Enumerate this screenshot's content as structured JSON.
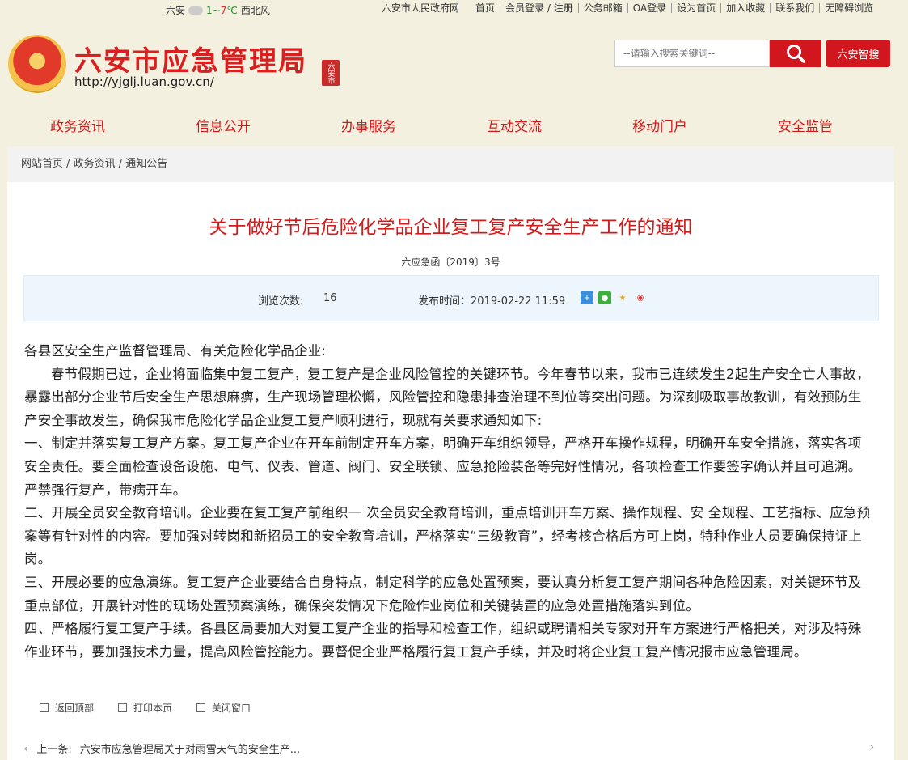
{
  "topbar": {
    "city": "六安",
    "temp_low": "1",
    "temp_sep": "~",
    "temp_high": "7",
    "temp_unit": "℃",
    "wind": "西北风",
    "links": [
      "六安市人民政府网",
      "首页",
      "会员登录 / 注册",
      "公务邮箱",
      "OA登录",
      "设为首页",
      "加入收藏",
      "联系我们",
      "无障碍浏览"
    ]
  },
  "header": {
    "title": "六安市应急管理局",
    "url": "http://yjglj.luan.gov.cn/",
    "seal_text": "六安市",
    "search_placeholder": "--请输入搜索关键词--",
    "smart_search": "六安智搜"
  },
  "nav": [
    "政务资讯",
    "信息公开",
    "办事服务",
    "互动交流",
    "移动门户",
    "安全监管"
  ],
  "breadcrumb": "网站首页 / 政务资讯 / 通知公告",
  "article": {
    "title": "关于做好节后危险化学品企业复工复产安全生产工作的通知",
    "doc_number": "六应急函〔2019〕3号",
    "views_label": "浏览次数:",
    "views": "16",
    "published_label": "发布时间：2019-02-22 11:59",
    "paragraphs": [
      "各县区安全生产监督管理局、有关危险化学品企业:",
      "春节假期已过，企业将面临集中复工复产，复工复产是企业风险管控的关键环节。今年春节以来，我市已连续发生2起生产安全亡人事故，暴露出部分企业节后安全生产思想麻痹，生产现场管理松懈，风险管控和隐患排查治理不到位等突出问题。为深刻吸取事故教训，有效预防生产安全事故发生，确保我市危险化学品企业复工复产顺利进行，现就有关要求通知如下:",
      "一、制定并落实复工复产方案。复工复产企业在开车前制定开车方案，明确开车组织领导，严格开车操作规程，明确开车安全措施，落实各项安全责任。要全面检查设备设施、电气、仪表、管道、阀门、安全联锁、应急抢险装备等完好性情况，各项检查工作要签字确认并且可追溯。严禁强行复产，带病开车。",
      "二、开展全员安全教育培训。企业要在复工复产前组织一 次全员安全教育培训，重点培训开车方案、操作规程、安 全规程、工艺指标、应急预案等有针对性的内容。要加强对转岗和新招员工的安全教育培训，严格落实“三级教育”，经考核合格后方可上岗，特种作业人员要确保持证上岗。",
      "三、开展必要的应急演练。复工复产企业要结合自身特点，制定科学的应急处置预案，要认真分析复工复产期间各种危险因素，对关键环节及重点部位，开展针对性的现场处置预案演练，确保突发情况下危险作业岗位和关键装置的应急处置措施落实到位。",
      "四、严格履行复工复产手续。各县区局要加大对复工复产企业的指导和检查工作，组织或聘请相关专家对开车方案进行严格把关，对涉及特殊作业环节，要加强技术力量，提高风险管控能力。要督促企业严格履行复工复产手续，并及时将企业复工复产情况报市应急管理局。"
    ]
  },
  "tools": [
    "返回顶部",
    "打印本页",
    "关闭窗口"
  ],
  "prev": {
    "label": "上一条:",
    "title": "六安市应急管理局关于对雨雪天气的安全生产..."
  },
  "colors": {
    "brand_red": "#d1171d",
    "page_bg": "#f3f0df",
    "info_bg": "#eef6fd"
  }
}
